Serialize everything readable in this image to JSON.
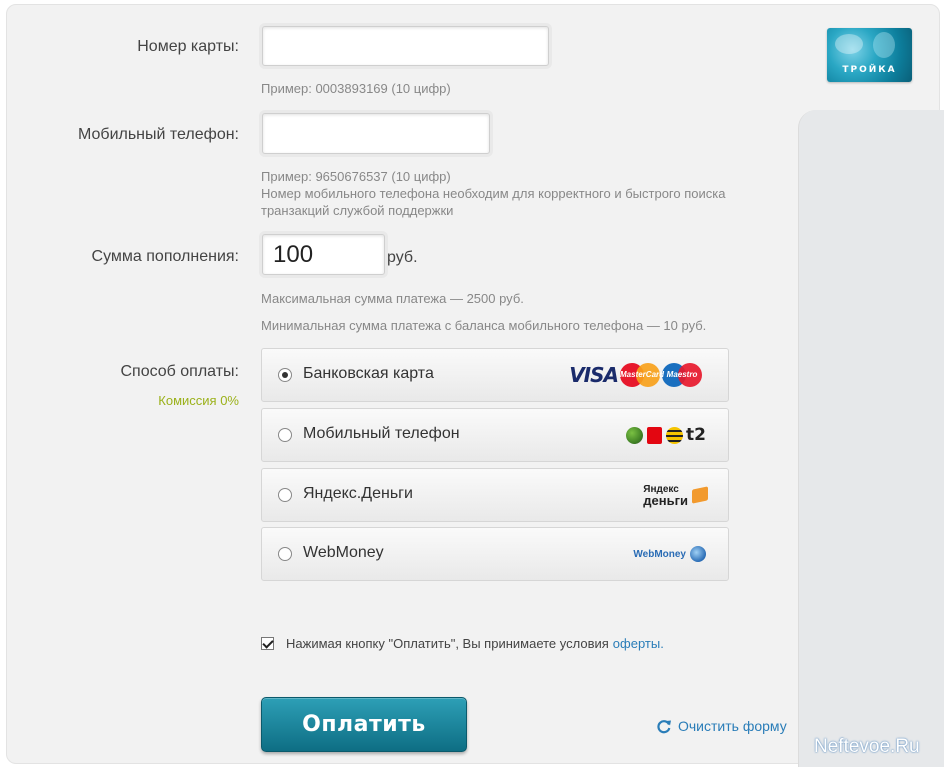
{
  "form": {
    "card_label": "Номер карты:",
    "card_value": "",
    "card_hint": "Пример: 0003893169 (10 цифр)",
    "phone_label": "Мобильный телефон:",
    "phone_value": "",
    "phone_hint_1": "Пример: 9650676537 (10 цифр)",
    "phone_hint_2": "Номер мобильного телефона необходим для корректного и быстрого поиска",
    "phone_hint_3": "транзакций службой поддержки",
    "amount_label": "Сумма пополнения:",
    "amount_value": "100",
    "amount_unit": "руб.",
    "max_hint": "Максимальная сумма платежа — 2500 руб.",
    "min_hint": "Минимальная сумма платежа с баланса мобильного телефона — 10 руб.",
    "method_label": "Способ оплаты:",
    "commission": "Комиссия 0%"
  },
  "payment_methods": [
    {
      "label": "Банковская карта",
      "selected": true,
      "logos": [
        "VISA",
        "MasterCard",
        "Maestro"
      ]
    },
    {
      "label": "Мобильный телефон",
      "selected": false,
      "logos": [
        "megafon",
        "mts",
        "beeline",
        "t2"
      ]
    },
    {
      "label": "Яндекс.Деньги",
      "selected": false,
      "logos": [
        "Яндекс",
        "деньги"
      ]
    },
    {
      "label": "WebMoney",
      "selected": false,
      "logos": [
        "WebMoney"
      ]
    }
  ],
  "agreement": {
    "text": "Нажимая кнопку \"Оплатить\", Вы принимаете условия",
    "link": "оферты.",
    "checked": true
  },
  "actions": {
    "pay_label": "Оплатить",
    "clear_label": "Очистить форму"
  },
  "brand": {
    "card_logo_text": "ТРОЙКА"
  },
  "watermark": "Neftevoe.Ru",
  "colors": {
    "accent": "#1a8aa3",
    "link": "#2a7db8",
    "commission": "#9bb11a"
  }
}
